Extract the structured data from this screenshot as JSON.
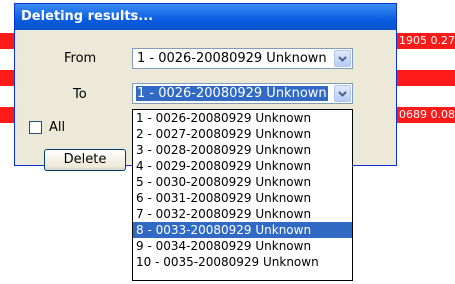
{
  "background": {
    "rows": [
      "1905 0.27",
      "",
      "0689 0.08"
    ],
    "row_color": "#ff1a1a"
  },
  "dialog": {
    "title": "Deleting results...",
    "from_label": "From",
    "to_label": "To",
    "from_value": "1 - 0026-20080929 Unknown",
    "to_value": "1 - 0026-20080929 Unknown",
    "all_label": "All",
    "all_checked": false,
    "delete_label": "Delete"
  },
  "dropdown": {
    "options": [
      "1 - 0026-20080929 Unknown",
      "2 - 0027-20080929 Unknown",
      "3 - 0028-20080929 Unknown",
      "4 - 0029-20080929 Unknown",
      "5 - 0030-20080929 Unknown",
      "6 - 0031-20080929 Unknown",
      "7 - 0032-20080929 Unknown",
      "8 - 0033-20080929 Unknown",
      "9 - 0034-20080929 Unknown",
      "10 - 0035-20080929 Unknown"
    ],
    "highlighted_index": 7
  },
  "colors": {
    "title_bar": "#0b5ce0",
    "selection": "#316ac5",
    "dialog_bg": "#ece9d8"
  }
}
